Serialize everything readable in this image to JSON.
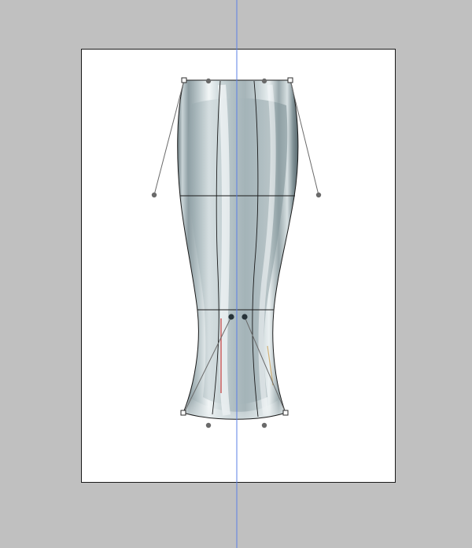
{
  "app": {
    "workspace_color": "#c0c0c0",
    "canvas_color": "#ffffff",
    "guide_color": "#5b7fe6"
  },
  "warp": {
    "mesh_line_color": "#1a1a1a",
    "handle_color": "#6a6a6a",
    "active_anchor_color": "#263238"
  },
  "artwork": {
    "subject": "glass-bottle",
    "base_color": "#a9b8bd",
    "highlight_color": "#eef3f4",
    "shadow_color": "#5f7176"
  }
}
